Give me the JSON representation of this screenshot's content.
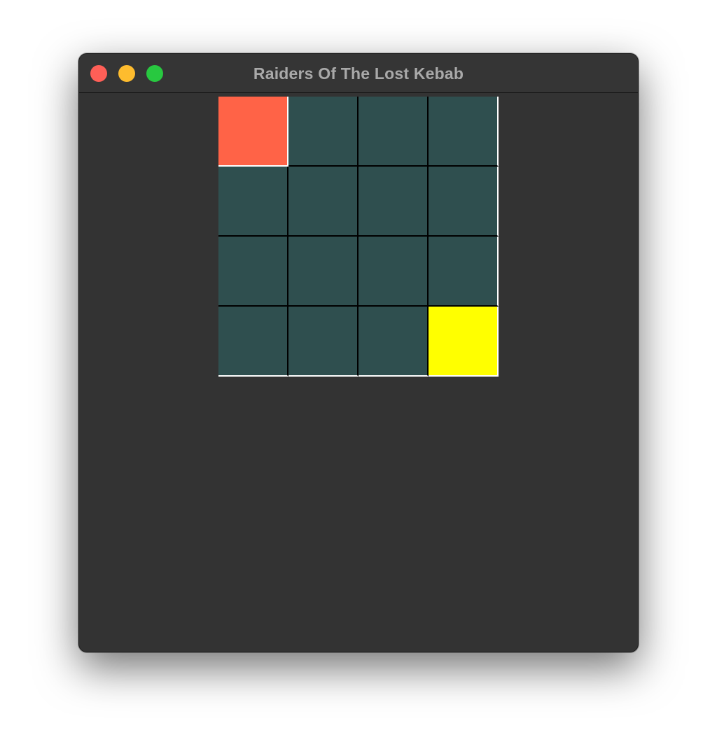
{
  "window": {
    "title": "Raiders Of The Lost Kebab"
  },
  "colors": {
    "window_background": "#333333",
    "titlebar_text": "#a9a9a9",
    "tile_empty": "#2f4f4f",
    "tile_player": "#ff6347",
    "tile_goal": "#ffff00",
    "grid_line": "#000000",
    "grid_edge": "#ffffff",
    "close_button": "#ff5f57",
    "minimize_button": "#febc2e",
    "zoom_button": "#28c840"
  },
  "board": {
    "rows": 4,
    "cols": 4,
    "cells": [
      [
        "player",
        "empty",
        "empty",
        "empty"
      ],
      [
        "empty",
        "empty",
        "empty",
        "empty"
      ],
      [
        "empty",
        "empty",
        "empty",
        "empty"
      ],
      [
        "empty",
        "empty",
        "empty",
        "goal"
      ]
    ]
  }
}
